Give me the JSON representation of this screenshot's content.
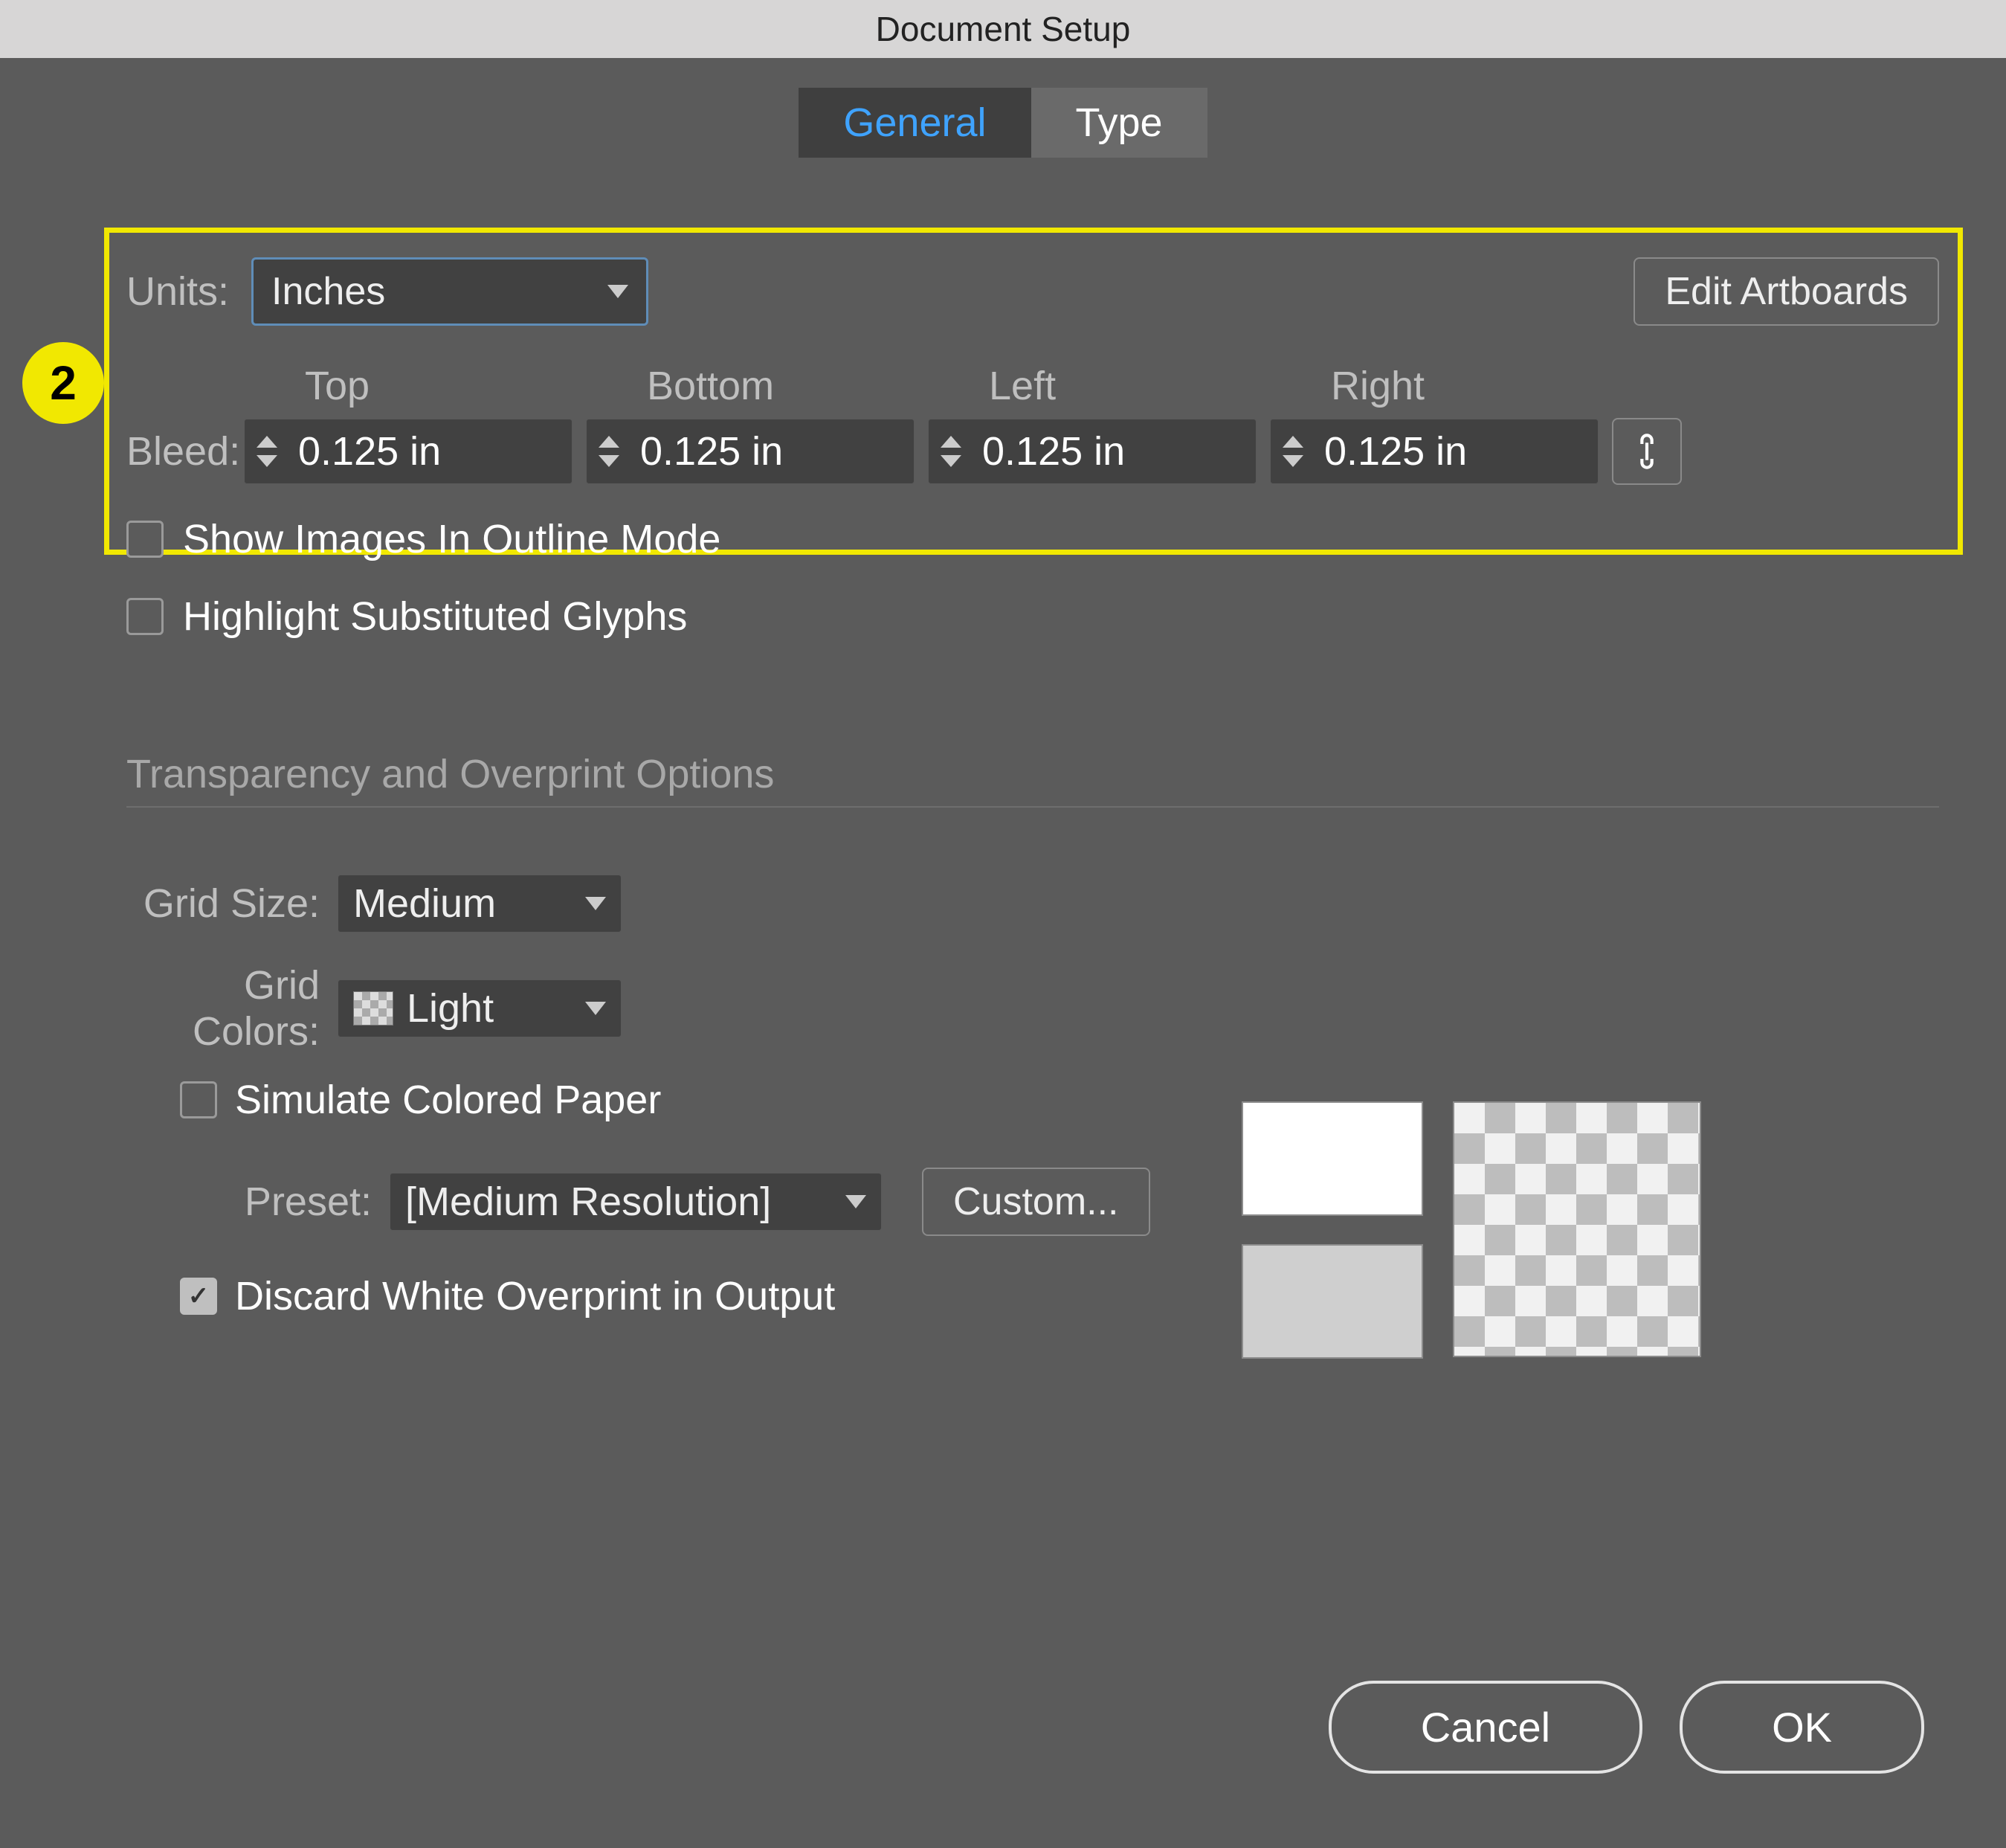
{
  "dialog": {
    "title": "Document Setup"
  },
  "tabs": {
    "general": "General",
    "type": "Type"
  },
  "annotation": {
    "step": "2"
  },
  "general": {
    "units_label": "Units:",
    "units_value": "Inches",
    "edit_artboards": "Edit Artboards",
    "bleed_label": "Bleed:",
    "bleed_headers": {
      "top": "Top",
      "bottom": "Bottom",
      "left": "Left",
      "right": "Right"
    },
    "bleed": {
      "top": "0.125 in",
      "bottom": "0.125 in",
      "left": "0.125 in",
      "right": "0.125 in"
    },
    "link_icon": "link-icon",
    "show_outline": "Show Images In Outline Mode",
    "highlight_glyphs": "Highlight Substituted Glyphs"
  },
  "transparency": {
    "section_title": "Transparency and Overprint Options",
    "grid_size_label": "Grid Size:",
    "grid_size_value": "Medium",
    "grid_colors_label": "Grid Colors:",
    "grid_colors_value": "Light",
    "simulate_label": "Simulate Colored Paper",
    "preset_label": "Preset:",
    "preset_value": "[Medium Resolution]",
    "custom_button": "Custom...",
    "discard_label": "Discard White Overprint in Output"
  },
  "footer": {
    "cancel": "Cancel",
    "ok": "OK"
  }
}
